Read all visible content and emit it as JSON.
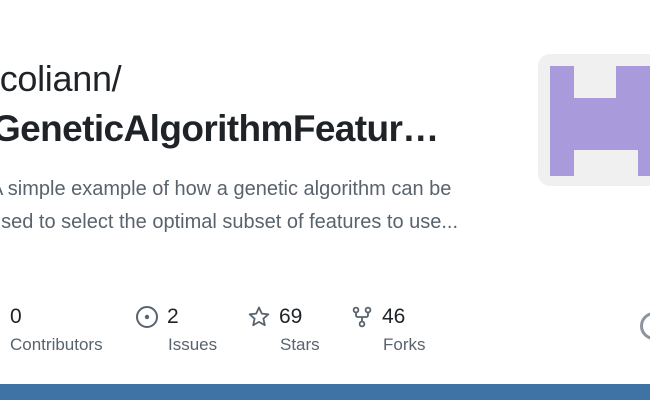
{
  "repo": {
    "owner": "rcoliann/",
    "name": "GeneticAlgorithmFeatur…",
    "description": "A simple example of how a genetic algorithm can be used to select the optimal subset of features to use..."
  },
  "stats": [
    {
      "icon": "people-icon",
      "value": "0",
      "label": "Contributors"
    },
    {
      "icon": "issue-icon",
      "value": "2",
      "label": "Issues"
    },
    {
      "icon": "star-icon",
      "value": "69",
      "label": "Stars"
    },
    {
      "icon": "fork-icon",
      "value": "46",
      "label": "Forks"
    }
  ],
  "avatar": {
    "icon": "identicon",
    "color": "#a99adc",
    "background": "#f0f0f0"
  },
  "colors": {
    "bottom_bar": "#3f73a6",
    "text": "#1f2328",
    "muted": "#59636e"
  }
}
